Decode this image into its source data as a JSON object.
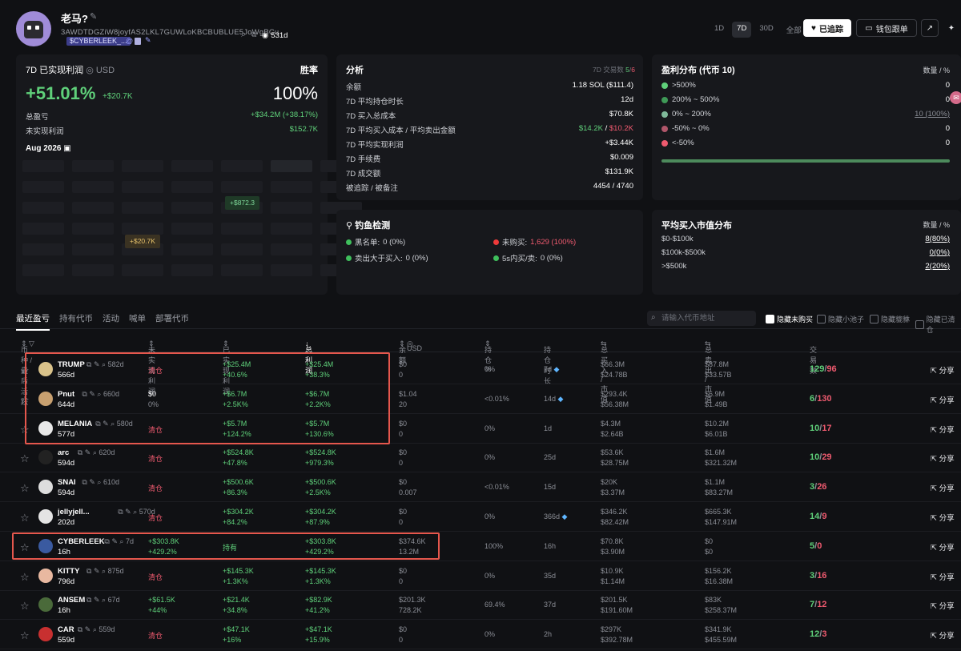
{
  "header": {
    "name": "老马?",
    "address": "3AWDTDGZiW8joyfAS2LKL7GUWLoKBCBUBLUE5JoWgBCu",
    "tag": "$CYBERLEEK_...",
    "age": "531d",
    "time_tabs": [
      "1D",
      "7D",
      "30D",
      "全部"
    ],
    "follow_label": "已追踪",
    "copy_label": "钱包跟单"
  },
  "pnl": {
    "title": "7D 已实现利润",
    "currency": "USD",
    "win_label": "胜率",
    "pct": "+51.01%",
    "amount": "+$20.7K",
    "win_rate": "100%",
    "total_label": "总盈亏",
    "total_value": "+$34.2M (+38.17%)",
    "unrealized_label": "未实现利润",
    "unrealized_value": "$152.7K",
    "month": "Aug 2026",
    "badge1": "+$872.3",
    "badge2": "+$20.7K"
  },
  "analysis": {
    "title": "分析",
    "tx_label": "7D 交易数",
    "tx_win": "5",
    "tx_loss": "6",
    "rows": [
      {
        "label": "余额",
        "value": "1.18 SOL ($111.4)"
      },
      {
        "label": "7D 平均持仓时长",
        "value": "12d"
      },
      {
        "label": "7D 买入总成本",
        "value": "$70.8K"
      },
      {
        "label": "7D 平均买入成本 / 平均卖出金额",
        "value_a": "$14.2K",
        "value_b": "$10.2K"
      },
      {
        "label": "7D 平均实现利润",
        "value": "+$3.44K"
      },
      {
        "label": "7D 手续费",
        "value": "$0.009"
      },
      {
        "label": "7D 成交额",
        "value": "$131.9K"
      },
      {
        "label": "被追踪 / 被备注",
        "value": "4454 / 4740"
      }
    ]
  },
  "dist": {
    "title": "盈利分布 (代币 10)",
    "qty_label": "数量 / %",
    "rows": [
      {
        "label": ">500%",
        "value": "0",
        "color": "#5fd07a"
      },
      {
        "label": "200% ~ 500%",
        "value": "0",
        "color": "#3f9a57"
      },
      {
        "label": "0% ~ 200%",
        "value": "10 (100%)",
        "color": "#7fb99a"
      },
      {
        "label": "-50% ~ 0%",
        "value": "0",
        "color": "#b0566a"
      },
      {
        "label": "<-50%",
        "value": "0",
        "color": "#ef5a6f"
      }
    ]
  },
  "phish": {
    "title": "钓鱼检测",
    "items": [
      {
        "label": "黑名单:",
        "value": "0 (0%)"
      },
      {
        "label": "未购买:",
        "value": "1,629 (100%)"
      },
      {
        "label": "卖出大于买入:",
        "value": "0 (0%)"
      },
      {
        "label": "5s内买/卖:",
        "value": "0 (0%)"
      }
    ]
  },
  "mcap": {
    "title": "平均买入市值分布",
    "qty_label": "数量 / %",
    "rows": [
      {
        "label": "$0-$100k",
        "value": "8(80%)"
      },
      {
        "label": "$100k-$500k",
        "value": "0(0%)"
      },
      {
        "label": ">$500k",
        "value": "2(20%)"
      }
    ]
  },
  "tabs": [
    "最近盈亏",
    "持有代币",
    "活动",
    "喊单",
    "部署代币"
  ],
  "search_placeholder": "请输入代币地址",
  "filters": [
    "隐藏未购买",
    "隐藏小池子",
    "隐藏貔貅",
    "隐藏已清仓"
  ],
  "columns": [
    "币种 / 最后活跃",
    "未实现利润",
    "已实现利润",
    "总利润",
    "余额",
    "USD",
    "持仓 %",
    "持仓时长",
    "总买入 / 市值",
    "总卖出 / 市值",
    "交易数"
  ],
  "share_label": "分享",
  "rows": [
    {
      "sym": "TRUMP",
      "ago": "582d",
      "age": "566d",
      "unreal": "清仓",
      "unreal2": "",
      "real": "+$25.4M",
      "real2": "+40.6%",
      "total": "+$25.4M",
      "total2": "+38.3%",
      "bal": "$0",
      "bal2": "0",
      "hold": "0%",
      "dur": "7d",
      "dia": true,
      "buy": "$66.3M",
      "buy2": "$24.78B",
      "sell": "$87.8M",
      "sell2": "$33.57B",
      "tw": "129",
      "tl": "96",
      "icolor": "#d9c28a"
    },
    {
      "sym": "Pnut",
      "ago": "660d",
      "age": "644d",
      "unreal": "$0",
      "unreal2": "0%",
      "real": "+$6.7M",
      "real2": "+2.5K%",
      "total": "+$6.7M",
      "total2": "+2.2K%",
      "bal": "$1.04",
      "bal2": "20",
      "hold": "<0.01%",
      "dur": "14d",
      "dia": true,
      "buy": "$293.4K",
      "buy2": "$56.38M",
      "sell": "$6.9M",
      "sell2": "$1.49B",
      "tw": "6",
      "tl": "130",
      "icolor": "#c8a070"
    },
    {
      "sym": "MELANIA",
      "ago": "580d",
      "age": "577d",
      "unreal": "清仓",
      "unreal2": "",
      "real": "+$5.7M",
      "real2": "+124.2%",
      "total": "+$5.7M",
      "total2": "+130.6%",
      "bal": "$0",
      "bal2": "0",
      "hold": "0%",
      "dur": "1d",
      "dia": false,
      "buy": "$4.3M",
      "buy2": "$2.64B",
      "sell": "$10.2M",
      "sell2": "$6.01B",
      "tw": "10",
      "tl": "17",
      "icolor": "#e8e8e8"
    },
    {
      "sym": "arc",
      "ago": "620d",
      "age": "594d",
      "unreal": "清仓",
      "unreal2": "",
      "real": "+$524.8K",
      "real2": "+47.8%",
      "total": "+$524.8K",
      "total2": "+979.3%",
      "bal": "$0",
      "bal2": "0",
      "hold": "0%",
      "dur": "25d",
      "dia": false,
      "buy": "$53.6K",
      "buy2": "$28.75M",
      "sell": "$1.6M",
      "sell2": "$321.32M",
      "tw": "10",
      "tl": "29",
      "icolor": "#222222"
    },
    {
      "sym": "SNAI",
      "ago": "610d",
      "age": "594d",
      "unreal": "清仓",
      "unreal2": "",
      "real": "+$500.6K",
      "real2": "+86.3%",
      "total": "+$500.6K",
      "total2": "+2.5K%",
      "bal": "$0",
      "bal2": "0.007",
      "hold": "<0.01%",
      "dur": "15d",
      "dia": false,
      "buy": "$20K",
      "buy2": "$3.37M",
      "sell": "$1.1M",
      "sell2": "$83.27M",
      "tw": "3",
      "tl": "26",
      "icolor": "#dddddd"
    },
    {
      "sym": "jellyjell...",
      "ago": "570d",
      "age": "202d",
      "unreal": "清仓",
      "unreal2": "",
      "real": "+$304.2K",
      "real2": "+84.2%",
      "total": "+$304.2K",
      "total2": "+87.9%",
      "bal": "$0",
      "bal2": "0",
      "hold": "0%",
      "dur": "366d",
      "dia": true,
      "buy": "$346.2K",
      "buy2": "$82.42M",
      "sell": "$665.3K",
      "sell2": "$147.91M",
      "tw": "14",
      "tl": "9",
      "icolor": "#e4e4e4"
    },
    {
      "sym": "CYBERLEEK",
      "ago": "7d",
      "age": "16h",
      "unreal": "+$303.8K",
      "unreal2": "+429.2%",
      "real": "持有",
      "real2": "",
      "total": "+$303.8K",
      "total2": "+429.2%",
      "bal": "$374.6K",
      "bal2": "13.2M",
      "hold": "100%",
      "dur": "16h",
      "dia": false,
      "buy": "$70.8K",
      "buy2": "$3.90M",
      "sell": "$0",
      "sell2": "$0",
      "tw": "5",
      "tl": "0",
      "icolor": "#3a5aa0"
    },
    {
      "sym": "KITTY",
      "ago": "875d",
      "age": "796d",
      "unreal": "清仓",
      "unreal2": "",
      "real": "+$145.3K",
      "real2": "+1.3K%",
      "total": "+$145.3K",
      "total2": "+1.3K%",
      "bal": "$0",
      "bal2": "0",
      "hold": "0%",
      "dur": "35d",
      "dia": false,
      "buy": "$10.9K",
      "buy2": "$1.14M",
      "sell": "$156.2K",
      "sell2": "$16.38M",
      "tw": "3",
      "tl": "16",
      "icolor": "#e8b8a0"
    },
    {
      "sym": "ANSEM",
      "ago": "67d",
      "age": "16h",
      "unreal": "+$61.5K",
      "unreal2": "+44%",
      "real": "+$21.4K",
      "real2": "+34.8%",
      "total": "+$82.9K",
      "total2": "+41.2%",
      "bal": "$201.3K",
      "bal2": "728.2K",
      "hold": "69.4%",
      "dur": "37d",
      "dia": false,
      "buy": "$201.5K",
      "buy2": "$191.60M",
      "sell": "$83K",
      "sell2": "$258.37M",
      "tw": "7",
      "tl": "12",
      "icolor": "#4a6a3a"
    },
    {
      "sym": "CAR",
      "ago": "559d",
      "age": "559d",
      "unreal": "清仓",
      "unreal2": "",
      "real": "+$47.1K",
      "real2": "+16%",
      "total": "+$47.1K",
      "total2": "+15.9%",
      "bal": "$0",
      "bal2": "0",
      "hold": "0%",
      "dur": "2h",
      "dia": false,
      "buy": "$297K",
      "buy2": "$392.78M",
      "sell": "$341.9K",
      "sell2": "$455.59M",
      "tw": "12",
      "tl": "3",
      "icolor": "#c83030"
    }
  ]
}
